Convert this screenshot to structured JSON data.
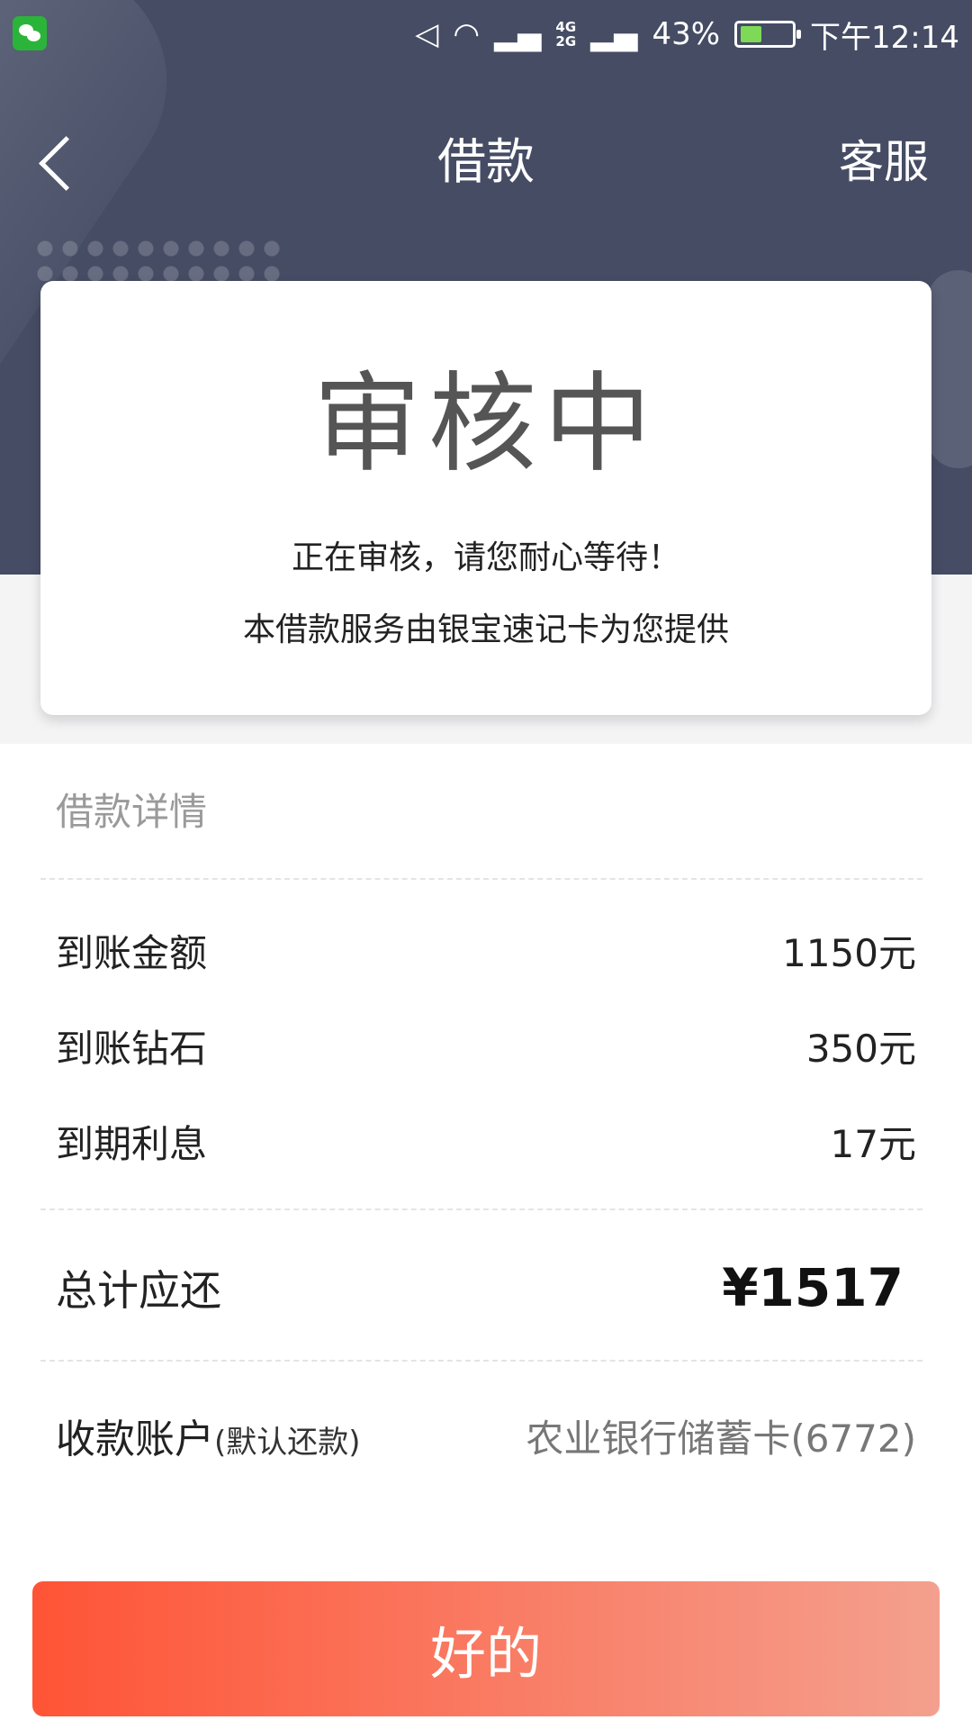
{
  "status_bar": {
    "battery_percent": "43%",
    "battery_level": 0.43,
    "time": "下午12:14",
    "network_top": "4G",
    "network_bottom": "2G",
    "icons": [
      "wechat-icon",
      "mute-icon",
      "wifi-icon",
      "signal-icon",
      "signal-icon-2",
      "battery-icon"
    ]
  },
  "nav": {
    "title": "借款",
    "service_label": "客服"
  },
  "card": {
    "status_title": "审核中",
    "message": "正在审核，请您耐心等待！",
    "provider": "本借款服务由银宝速记卡为您提供"
  },
  "details": {
    "section_title": "借款详情",
    "items": [
      {
        "label": "到账金额",
        "value": "1150元"
      },
      {
        "label": "到账钻石",
        "value": "350元"
      },
      {
        "label": "到期利息",
        "value": "17元"
      }
    ],
    "total_label": "总计应还",
    "total_value": "¥1517",
    "account_label": "收款账户",
    "account_sublabel": "(默认还款)",
    "account_value": "农业银行储蓄卡(6772)"
  },
  "confirm_button": "好的",
  "colors": {
    "header": "#454c64",
    "button_start": "#ff5436",
    "button_end": "#f4a08e"
  }
}
